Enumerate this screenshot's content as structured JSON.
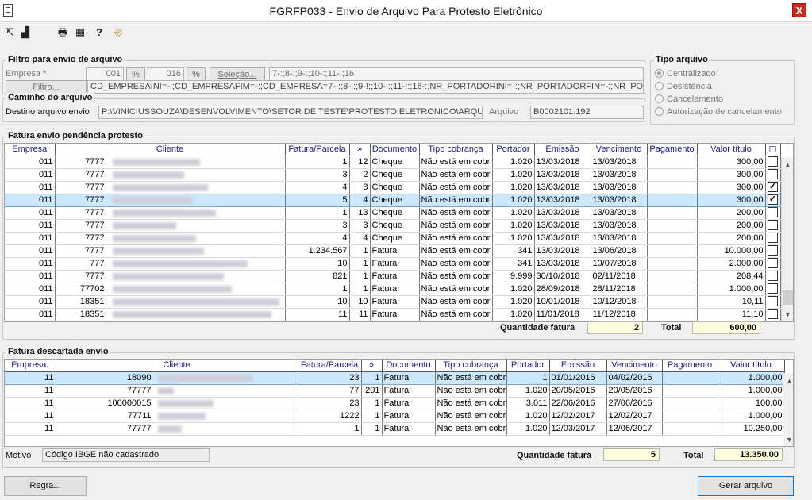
{
  "window": {
    "title": "FGRFP033 - Envio de Arquivo Para Protesto Eletrônico",
    "close": "X"
  },
  "toolbar": {
    "icons": [
      "arrow-icon",
      "layers-icon",
      "print-icon",
      "calendar-icon",
      "help-icon",
      "exit-door-icon"
    ],
    "glyphs": [
      "⇱",
      "▟",
      "🖶",
      "▦",
      "?",
      "⎆"
    ]
  },
  "filtro": {
    "title": "Filtro para envio de arquivo",
    "empresa_label": "Empresa *",
    "empresa_ini": "001",
    "empresa_fim": "016",
    "range_sym": "%",
    "selecao_label": "Seleção...",
    "selecao_value": "7-:;8-:;9-:;10-:;11-:;16",
    "filtro_label": "Filtro...",
    "filtro_value": "CD_EMPRESAINI=-:;CD_EMPRESAFIM=-:;CD_EMPRESA=7-!:;8-!:;9-!:;10-!:;11-!:;16-:;NR_PORTADORINI=-:;NR_PORTADORFIN=-:;NR_PORTADOR=-:;NR"
  },
  "tipo": {
    "title": "Tipo arquivo",
    "options": [
      "Centralizado",
      "Desistência",
      "Cancelamento",
      "Autorização de cancelamento"
    ],
    "selected": 0
  },
  "caminho": {
    "title": "Caminho do arquivo",
    "destino_label": "Destino arquivo envio",
    "destino_value": "P:\\VINICIUSSOUZA\\DESENVOLVIMENTO\\SETOR DE TESTE\\PROTESTO ELETRONICO\\ARQUIVOS_GE",
    "arquivo_label": "Arquivo",
    "arquivo_value": "B0002101.192"
  },
  "pendencia": {
    "title": "Fatura envio pendência protesto",
    "headers": [
      "Empresa",
      "Cliente",
      "Fatura/Parcela",
      "»",
      "Documento",
      "Tipo cobrança",
      "Portador",
      "Emissão",
      "Vencimento",
      "Pagamento",
      "Valor título",
      "☐"
    ],
    "rows": [
      [
        "011",
        "7777",
        "1",
        "12",
        "Cheque",
        "Não está em cobr",
        "1.020",
        "13/03/2018",
        "13/03/2018",
        "",
        "300,00",
        false
      ],
      [
        "011",
        "7777",
        "3",
        "2",
        "Cheque",
        "Não está em cobr",
        "1.020",
        "13/03/2018",
        "13/03/2018",
        "",
        "300,00",
        false
      ],
      [
        "011",
        "7777",
        "4",
        "3",
        "Cheque",
        "Não está em cobr",
        "1.020",
        "13/03/2018",
        "13/03/2018",
        "",
        "300,00",
        true
      ],
      [
        "011",
        "7777",
        "5",
        "4",
        "Cheque",
        "Não está em cobr",
        "1.020",
        "13/03/2018",
        "13/03/2018",
        "",
        "300,00",
        true
      ],
      [
        "011",
        "7777",
        "1",
        "13",
        "Cheque",
        "Não está em cobr",
        "1.020",
        "13/03/2018",
        "13/03/2018",
        "",
        "200,00",
        false
      ],
      [
        "011",
        "7777",
        "3",
        "3",
        "Cheque",
        "Não está em cobr",
        "1.020",
        "13/03/2018",
        "13/03/2018",
        "",
        "200,00",
        false
      ],
      [
        "011",
        "7777",
        "4",
        "4",
        "Cheque",
        "Não está em cobr",
        "1.020",
        "13/03/2018",
        "13/03/2018",
        "",
        "200,00",
        false
      ],
      [
        "011",
        "7777",
        "1.234.567",
        "1",
        "Fatura",
        "Não está em cobr",
        "341",
        "13/03/2018",
        "13/06/2018",
        "",
        "10.000,00",
        false
      ],
      [
        "011",
        "777",
        "10",
        "1",
        "Fatura",
        "Não está em cobr",
        "341",
        "13/03/2018",
        "10/07/2018",
        "",
        "2.000,00",
        false
      ],
      [
        "011",
        "7777",
        "821",
        "1",
        "Fatura",
        "Não está em cobr",
        "9.999",
        "30/10/2018",
        "02/11/2018",
        "",
        "208,44",
        false
      ],
      [
        "011",
        "77702",
        "1",
        "1",
        "Fatura",
        "Não está em cobr",
        "1.020",
        "28/09/2018",
        "28/11/2018",
        "",
        "1.000,00",
        false
      ],
      [
        "011",
        "18351",
        "10",
        "10",
        "Fatura",
        "Não está em cobr",
        "1.020",
        "10/01/2018",
        "10/12/2018",
        "",
        "10,11",
        false
      ],
      [
        "011",
        "18351",
        "11",
        "11",
        "Fatura",
        "Não está em cobr",
        "1.020",
        "11/01/2018",
        "11/12/2018",
        "",
        "11,10",
        false
      ]
    ],
    "selected_row": 3,
    "qtd_label": "Quantidade fatura",
    "qtd_value": "2",
    "total_label": "Total",
    "total_value": "600,00"
  },
  "descartada": {
    "title": "Fatura descartada envio",
    "headers": [
      "Empresa.",
      "Cliente",
      "Fatura/Parcela",
      "»",
      "Documento",
      "Tipo cobrança",
      "Portador",
      "Emissão",
      "Vencimento",
      "Pagamento",
      "Valor título"
    ],
    "rows": [
      [
        "11",
        "18090",
        "23",
        "1",
        "Fatura",
        "Não está em cobr",
        "1",
        "01/01/2016",
        "04/02/2016",
        "",
        "1.000,00"
      ],
      [
        "11",
        "77777",
        "77",
        "201",
        "Fatura",
        "Não está em cobr",
        "1.020",
        "20/05/2016",
        "20/05/2016",
        "",
        "1.000,00"
      ],
      [
        "11",
        "100000015",
        "23",
        "1",
        "Fatura",
        "Não está em cobr",
        "3.011",
        "22/06/2016",
        "27/06/2016",
        "",
        "100,00"
      ],
      [
        "11",
        "77711",
        "1222",
        "1",
        "Fatura",
        "Não está em cobr",
        "1.020",
        "12/02/2017",
        "12/02/2017",
        "",
        "1.000,00"
      ],
      [
        "11",
        "77777",
        "1",
        "1",
        "Fatura",
        "Não está em cobr",
        "1.020",
        "12/03/2017",
        "12/06/2017",
        "",
        "10.250,00"
      ]
    ],
    "selected_row": 0,
    "motivo_label": "Motivo",
    "motivo_value": "Código IBGE não cadastrado",
    "qtd_label": "Quantidade fatura",
    "qtd_value": "5",
    "total_label": "Total",
    "total_value": "13.350,00"
  },
  "buttons": {
    "regra": "Regra...",
    "gerar": "Gerar arquivo"
  }
}
